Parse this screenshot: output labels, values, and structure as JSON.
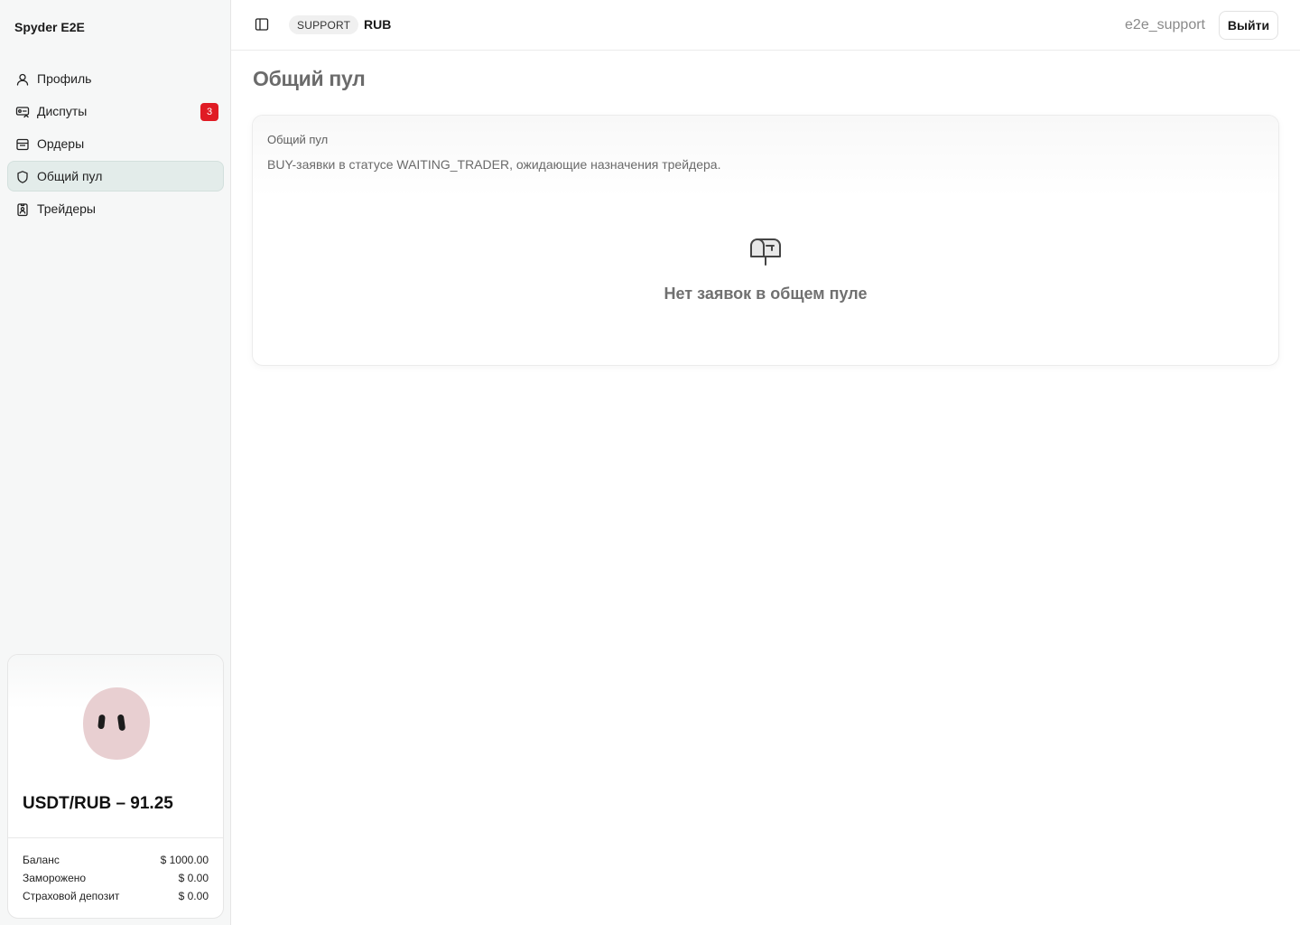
{
  "app": {
    "brand": "Spyder E2E"
  },
  "sidebar": {
    "items": [
      {
        "label": "Профиль",
        "icon": "user-icon"
      },
      {
        "label": "Диспуты",
        "icon": "dispute-icon",
        "badge": "3"
      },
      {
        "label": "Ордеры",
        "icon": "orders-icon"
      },
      {
        "label": "Общий пул",
        "icon": "shield-icon",
        "active": true
      },
      {
        "label": "Трейдеры",
        "icon": "traders-icon"
      }
    ]
  },
  "wallet": {
    "rate": "USDT/RUB – 91.25",
    "rows": [
      {
        "label": "Баланс",
        "value": "$ 1000.00"
      },
      {
        "label": "Заморожено",
        "value": "$ 0.00"
      },
      {
        "label": "Страховой депозит",
        "value": "$ 0.00"
      }
    ]
  },
  "header": {
    "role": "SUPPORT",
    "currency": "RUB",
    "username": "e2e_support",
    "logout_label": "Выйти"
  },
  "main": {
    "title": "Общий пул",
    "card": {
      "title": "Общий пул",
      "description": "BUY-заявки в статусе WAITING_TRADER, ожидающие назначения трейдера.",
      "empty_icon": "mailbox-icon",
      "empty_text": "Нет заявок в общем пуле"
    }
  },
  "colors": {
    "accent_active": "#e3ecea",
    "badge": "#e01b24",
    "avatar_blob": "#e8cfd1"
  }
}
